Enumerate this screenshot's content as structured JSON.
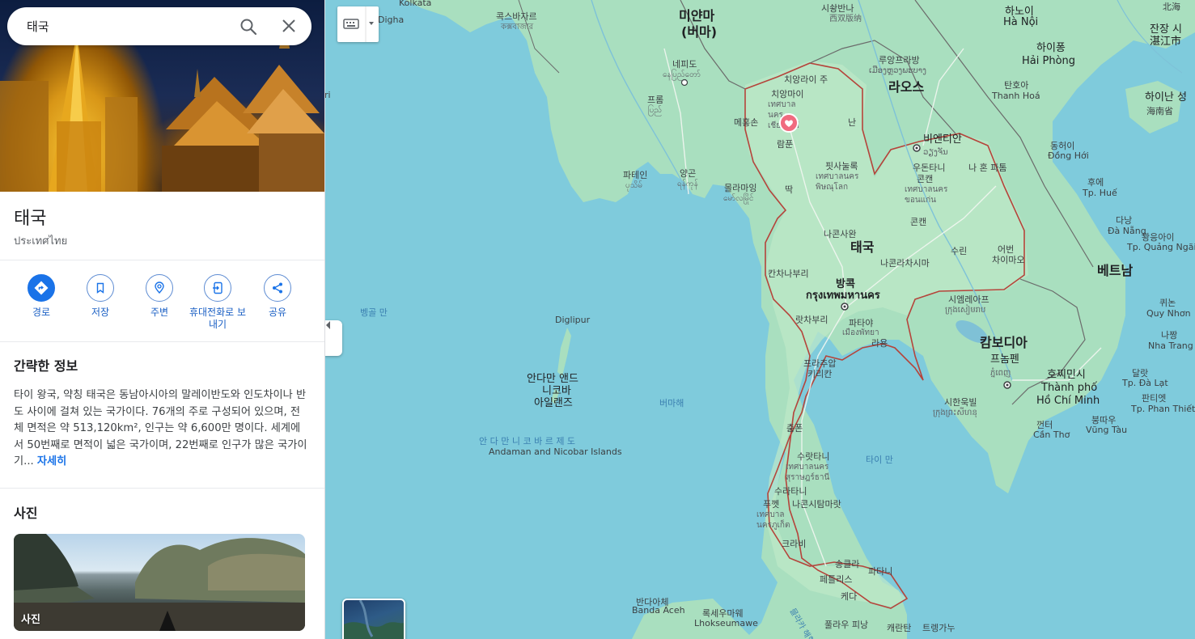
{
  "search": {
    "query": "태국"
  },
  "place": {
    "title": "태국",
    "subtitle": "ประเทศไทย"
  },
  "actions": [
    {
      "label": "경로",
      "icon": "directions-icon"
    },
    {
      "label": "저장",
      "icon": "bookmark-icon"
    },
    {
      "label": "주변",
      "icon": "nearby-icon"
    },
    {
      "label": "휴대전화로 보내기",
      "icon": "send-to-phone-icon"
    },
    {
      "label": "공유",
      "icon": "share-icon"
    }
  ],
  "about": {
    "title": "간략한 정보",
    "text": "타이 왕국, 약칭 태국은 동남아시아의 말레이반도와 인도차이나 반도 사이에 걸쳐 있는 국가이다. 76개의 주로 구성되어 있으며, 전체 면적은 약 513,120km², 인구는 약 6,600만 명이다. 세계에서 50번째로 면적이 넓은 국가이며, 22번째로 인구가 많은 국가이기...",
    "more": "자세히"
  },
  "photos": {
    "title": "사진",
    "card_label": "사진"
  },
  "map": {
    "labels": {
      "kolkata": "Kolkata",
      "digha": "Digha",
      "cox": "콕스바자르",
      "cox_native": "কক্সবাজার",
      "myanmar": "미얀마",
      "myanmar2": "(버마)",
      "naypyidaw": "네피도",
      "naypyidaw_native": "နေပြည်တော်",
      "prome": "프롬",
      "prome_native": "ပြည်",
      "pathein": "파테인",
      "pathein_native": "ပုသိမ်",
      "yangon": "양곤",
      "yangon_native": "ရန်ကုန်",
      "mawlamyine": "몰라마잉",
      "mawlamyine_native": "မော်လမြိုင်",
      "rangoon_ri": "ri",
      "xishuangbanna": "시솽반나",
      "xishuangbanna_native": "西双版纳",
      "laos": "라오스",
      "luangprabang": "루앙프라방",
      "luangprabang_native": "ເມືອງຫຼວງພະບາງ",
      "vientiane": "비엔티안",
      "vientiane_native": "ວຽງຈັນ",
      "chiangrai": "치앙라이 주",
      "chiangmai": "치앙마이",
      "chiangmai_native": "เทศบาลนคร เชียงใหม่",
      "maehongson": "메홍손",
      "nan": "난",
      "lamphun": "람푼",
      "phitsanulok": "핏사눌록",
      "phitsanulok_native": "เทศบาลนคร พิษณุโลก",
      "tak": "딱",
      "udon": "우돈타니",
      "khonkaen": "콘캔",
      "khonkaen_native": "เทศบาลนคร ขอนแก่น",
      "khonkaen2": "콘캔",
      "nakhonsawan": "나콘사완",
      "thailand": "태국",
      "nakhonratchasima": "나콘라차시마",
      "surin": "수린",
      "ubon": "어번",
      "ubon2": "차이마오",
      "kanchanaburi": "칸차나부리",
      "bangkok": "방콕",
      "bangkok_native": "กรุงเทพมหานคร",
      "ratchaburi": "랏차부리",
      "pattaya": "파타야",
      "pattaya_native": "เมืองพัทยา",
      "rayong": "라용",
      "prachuap": "프라추압",
      "prachuap2": "키리칸",
      "chumphon": "춤폰",
      "suratthani": "수랏타니",
      "suratthani_native": "เทศบาลนคร สุราษฎร์ธานี",
      "surathani2": "수라타니",
      "phuket": "푸껫",
      "phuket_native": "เทศบาล นครภูเก็ต",
      "nakhonsi": "나콘시탐마랏",
      "krabi": "크라비",
      "songkhla": "송클라",
      "pattani": "파타니",
      "phattalung": "페틀리스",
      "kedah": "케다",
      "pulau_pinang": "풀라우 피낭",
      "kelantan": "캐란탄",
      "terengganu": "트렝가누",
      "vietnam": "베트남",
      "hanoi": "하노이",
      "hanoi_native": "Hà Nội",
      "haiphong": "하이퐁",
      "haiphong_native": "Hải Phòng",
      "thanhhoa": "탄호아",
      "thanhhoa_native": "Thanh Hoá",
      "hainan": "하이난 성",
      "hainan_native": "海南省",
      "zhanjiang": "잔장 시",
      "zhanjiang_native": "湛江市",
      "beihai": "北海",
      "donghoi": "동허이",
      "donghoi_native": "Đồng Hới",
      "hue": "후에",
      "hue_native": "Tp. Huế",
      "danang": "다낭",
      "danang_native": "Đà Nẵng",
      "quangngai": "꽝응아이",
      "quangngai_native": "Tp. Quảng Ngãi",
      "quynhon": "퀴논",
      "quynhon_native": "Quy Nhơn",
      "nhatrang": "나짱",
      "nhatrang_native": "Nha Trang",
      "dalat": "달랏",
      "dalat_native": "Tp. Đà Lạt",
      "phanthiet": "판티엣",
      "phanthiet_native": "Tp. Phan Thiết",
      "vungtau": "붕따우",
      "vungtau_native": "Vũng Tàu",
      "hcmc": "호찌민시",
      "hcmc_native1": "Thành phố",
      "hcmc_native2": "Hồ Chí Minh",
      "cantho": "껀터",
      "cantho_native": "Cần Thơ",
      "cambodia": "캄보디아",
      "siemreap": "시엠레아프",
      "siemreap_native": "ក្រុងសៀមរាប",
      "phnompenh": "프놈펜",
      "phnompenh_native": "ភ្នំពេញ",
      "sihanoukville": "시한욱빌",
      "sihanoukville_native": "ក្រុងព្រះសីហនុ",
      "naxon": "나 혼 파톰",
      "bay_bengal": "벵골 만",
      "diglipur": "Diglipur",
      "andaman1": "안다만 앤드",
      "andaman2": "니코바",
      "andaman3": "아일랜즈",
      "andaman_islands_kr": "안 다 만   니 코 바 르   제 도",
      "andaman_islands_en": "Andaman and Nicobar Islands",
      "andaman_sea": "버마해",
      "gulf_thailand": "타이 만",
      "bandaaceh": "반다아체",
      "bandaaceh_native": "Banda Aceh",
      "lhokseumawe": "록세우마웨",
      "lhokseumawe_native": "Lhokseumawe",
      "malacca": "믈라카 해협"
    },
    "colors": {
      "water": "#7fcbdc",
      "land": "#a9dfbf",
      "border": "#b5443b",
      "pin": "#f06b7f"
    }
  }
}
